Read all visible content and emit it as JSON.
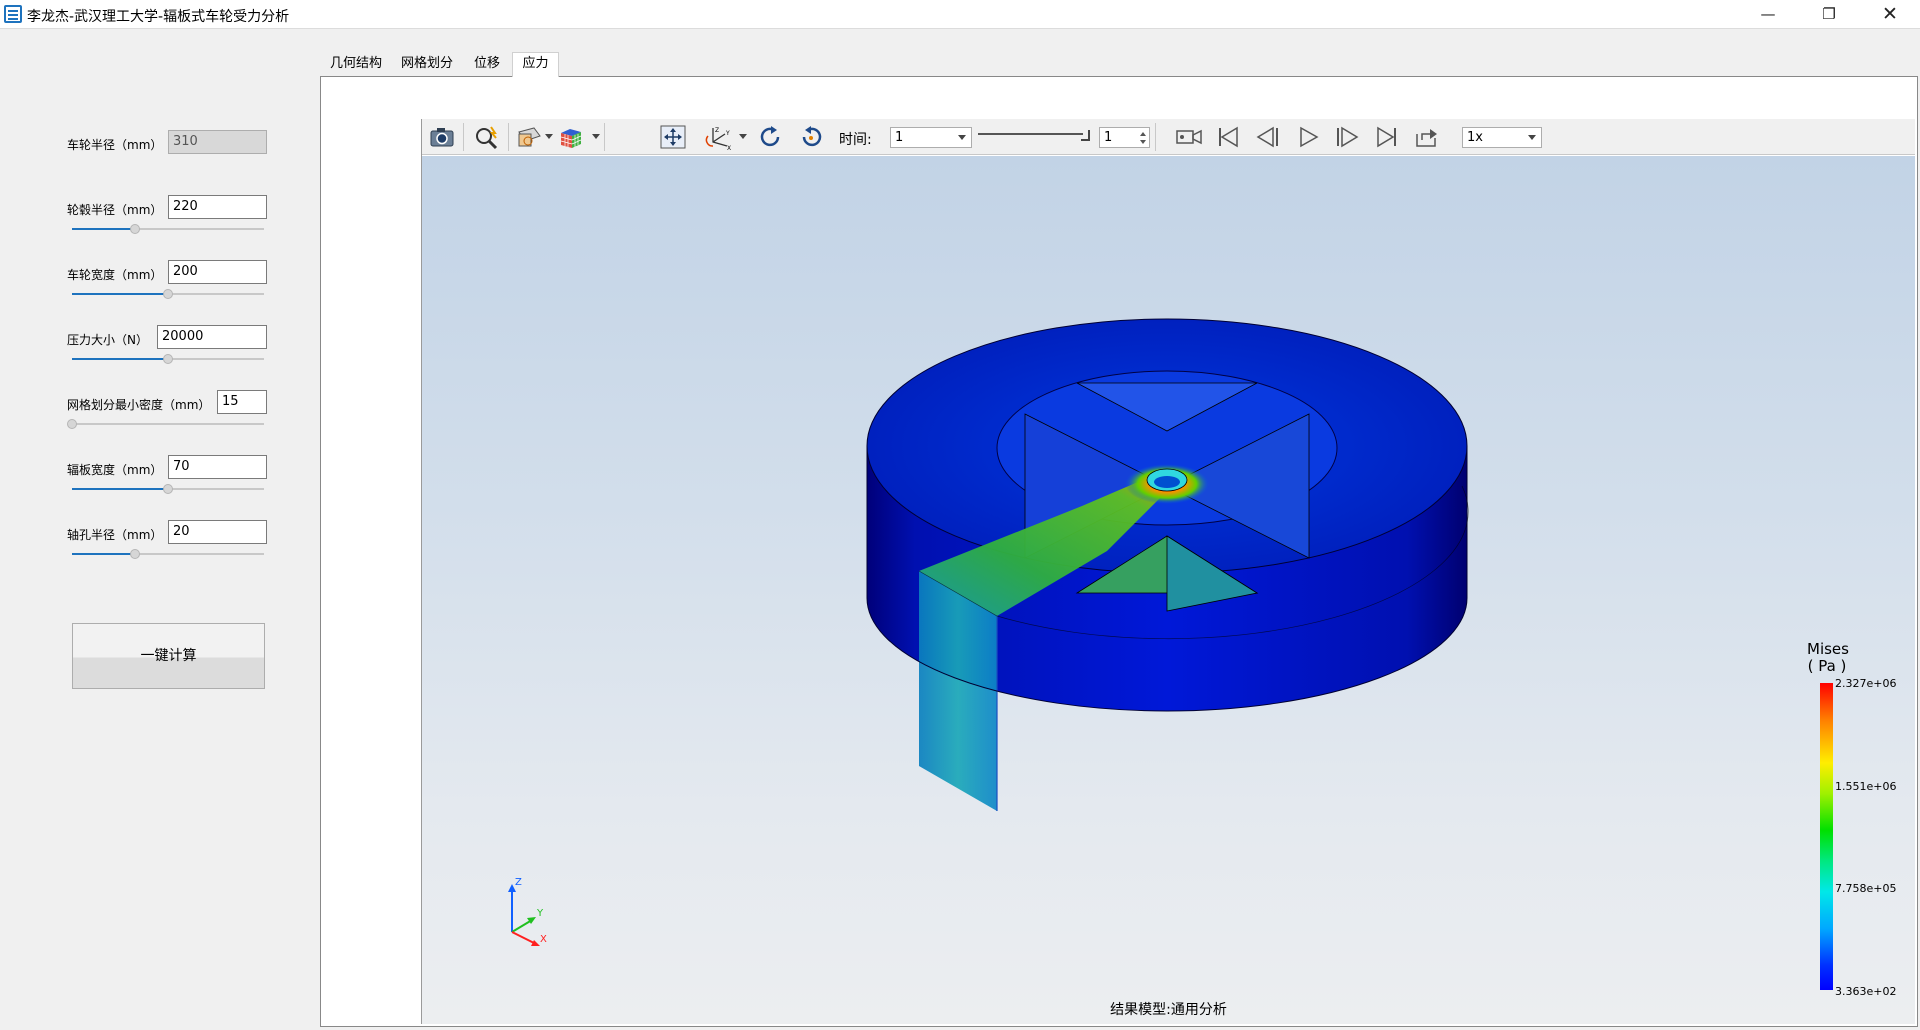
{
  "window": {
    "title": "李龙杰-武汉理工大学-辐板式车轮受力分析",
    "min_icon": "minimize-icon",
    "max_icon": "restore-icon",
    "close_icon": "close-icon",
    "min_glyph": "—",
    "max_glyph": "❐",
    "close_glyph": "✕"
  },
  "params": [
    {
      "label": "车轮半径（mm）",
      "value": "310",
      "disabled": true
    },
    {
      "label": "轮毂半径（mm）",
      "value": "220",
      "slider": 0.33
    },
    {
      "label": "车轮宽度（mm）",
      "value": "200",
      "slider": 0.5
    },
    {
      "label": "压力大小（N）",
      "value": "20000",
      "slider": 0.5
    },
    {
      "label": "网格划分最小密度（mm）",
      "value": "15",
      "slider": 0.0
    },
    {
      "label": "辐板宽度（mm）",
      "value": "70",
      "slider": 0.5
    },
    {
      "label": "轴孔半径（mm）",
      "value": "20",
      "slider": 0.33
    }
  ],
  "calc_button": "一键计算",
  "tabs": [
    "几何结构",
    "网格划分",
    "位移",
    "应力"
  ],
  "active_tab": 3,
  "toolbar": {
    "time_label": "时间:",
    "time_value": "1",
    "frame_value": "1",
    "speed_value": "1x",
    "icons": [
      "camera-icon",
      "probe-icon",
      "clip-plane-icon",
      "color-cube-icon",
      "fit-view-icon",
      "axes-orient-icon",
      "rotate-cw-icon",
      "rotate-ccw-icon",
      "record-icon",
      "first-frame-icon",
      "prev-frame-icon",
      "play-icon",
      "next-frame-icon",
      "last-frame-icon",
      "export-icon"
    ]
  },
  "legend": {
    "title_line1": "Mises",
    "title_line2": "( Pa )",
    "ticks": [
      "2.327e+06",
      "1.551e+06",
      "7.758e+05",
      "3.363e+02"
    ],
    "max": 2327000,
    "min": 336.3
  },
  "axes": {
    "x": "X",
    "y": "Y",
    "z": "Z"
  },
  "status": "结果模型:通用分析",
  "colors": {
    "accent": "#1e73be",
    "stress_low": "#0000ff",
    "stress_high": "#ff0000"
  }
}
